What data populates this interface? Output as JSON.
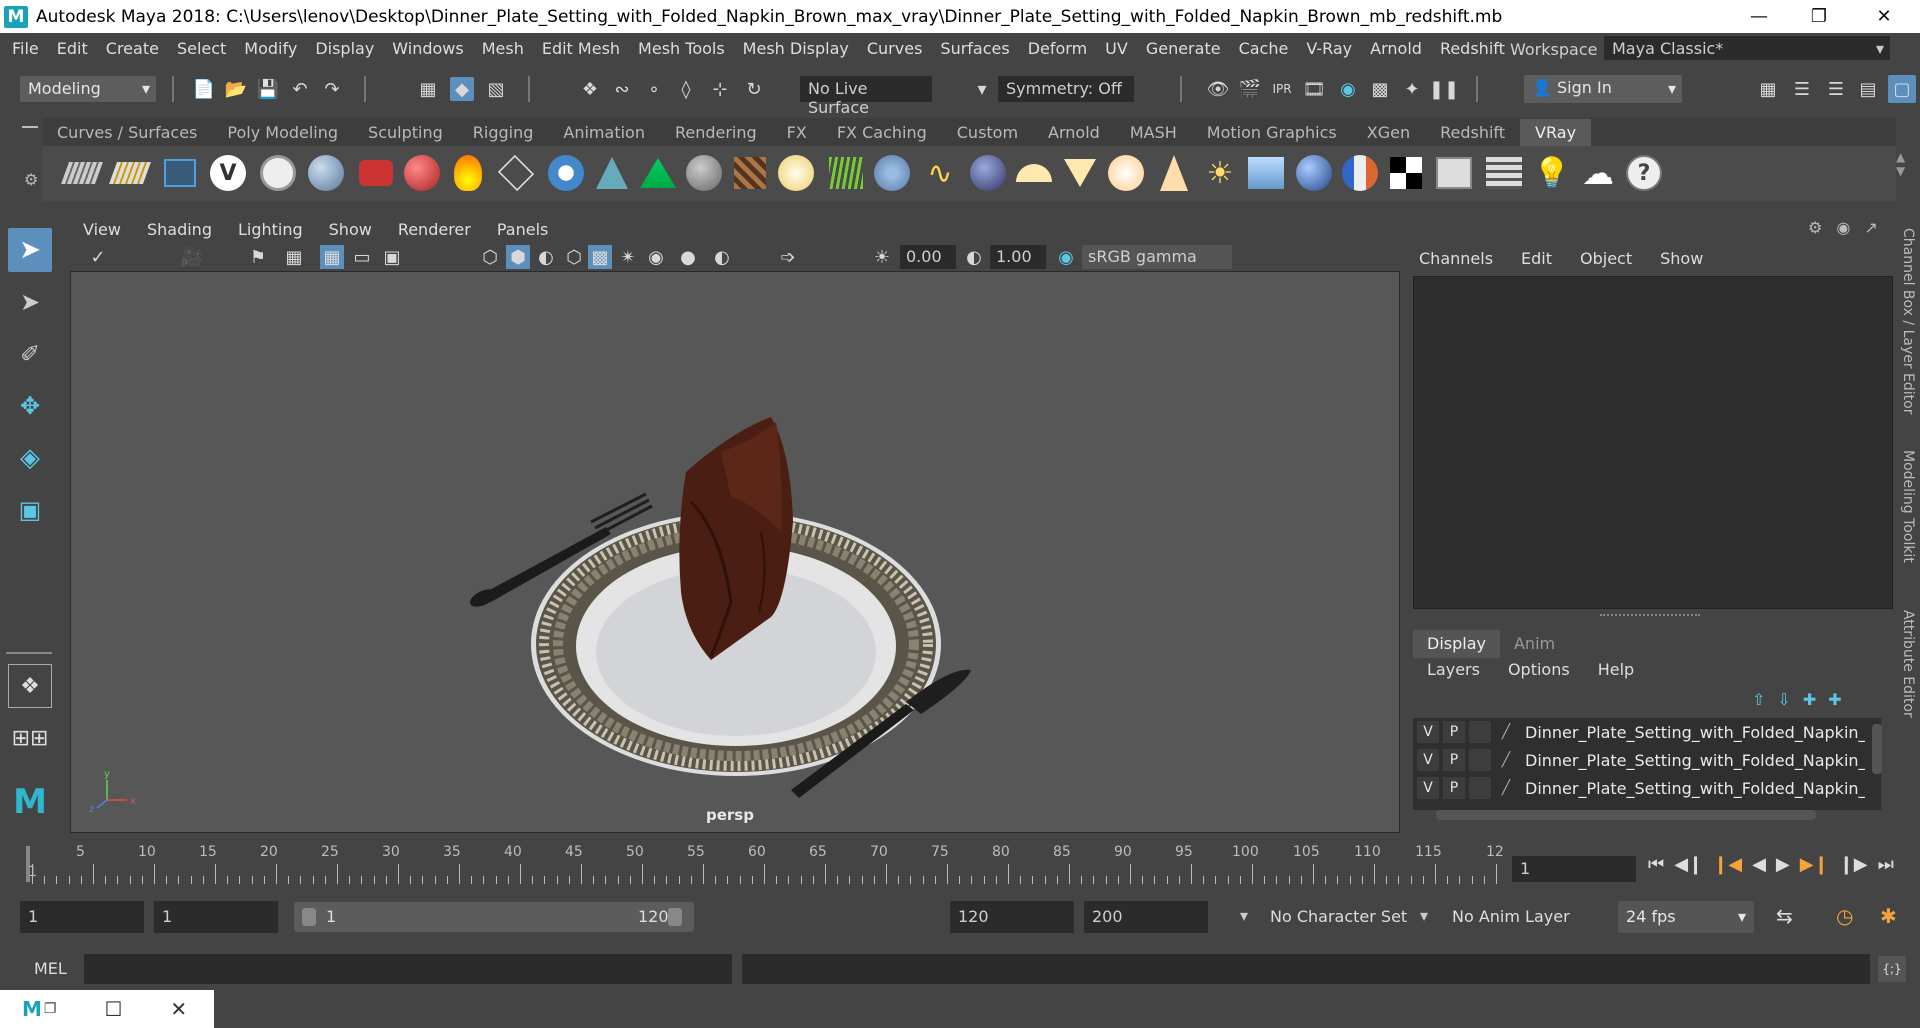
{
  "window": {
    "title": "Autodesk Maya 2018: C:\\Users\\lenov\\Desktop\\Dinner_Plate_Setting_with_Folded_Napkin_Brown_max_vray\\Dinner_Plate_Setting_with_Folded_Napkin_Brown_mb_redshift.mb",
    "logo": "M"
  },
  "menu": [
    "File",
    "Edit",
    "Create",
    "Select",
    "Modify",
    "Display",
    "Windows",
    "Mesh",
    "Edit Mesh",
    "Mesh Tools",
    "Mesh Display",
    "Curves",
    "Surfaces",
    "Deform",
    "UV",
    "Generate",
    "Cache",
    "V-Ray",
    "Arnold",
    "Redshift"
  ],
  "workspace": {
    "label": "Workspace :",
    "value": "Maya Classic*"
  },
  "status": {
    "mode": "Modeling",
    "live_surface": "No Live Surface",
    "symmetry": "Symmetry: Off",
    "sign_in": "Sign In"
  },
  "shelf": {
    "tabs": [
      "Curves / Surfaces",
      "Poly Modeling",
      "Sculpting",
      "Rigging",
      "Animation",
      "Rendering",
      "FX",
      "FX Caching",
      "Custom",
      "Arnold",
      "MASH",
      "Motion Graphics",
      "XGen",
      "Redshift",
      "VRay"
    ],
    "active_tab": "VRay"
  },
  "viewport": {
    "menu": [
      "View",
      "Shading",
      "Lighting",
      "Show",
      "Renderer",
      "Panels"
    ],
    "exposure": "0.00",
    "gamma": "1.00",
    "color_space": "sRGB gamma",
    "camera": "persp"
  },
  "channel_box": {
    "menu": [
      "Channels",
      "Edit",
      "Object",
      "Show"
    ]
  },
  "layer_editor": {
    "tabs": [
      "Display",
      "Anim"
    ],
    "menu": [
      "Layers",
      "Options",
      "Help"
    ],
    "layers": [
      {
        "v": "V",
        "p": "P",
        "name": "Dinner_Plate_Setting_with_Folded_Napkin_Brow"
      },
      {
        "v": "V",
        "p": "P",
        "name": "Dinner_Plate_Setting_with_Folded_Napkin_Brow"
      },
      {
        "v": "V",
        "p": "P",
        "name": "Dinner_Plate_Setting_with_Folded_Napkin_Brow"
      }
    ]
  },
  "side_tabs": [
    "Channel Box / Layer Editor",
    "Modeling Toolkit",
    "Attribute Editor"
  ],
  "timeline": {
    "labels": [
      "1",
      "5",
      "10",
      "15",
      "20",
      "25",
      "30",
      "35",
      "40",
      "45",
      "50",
      "55",
      "60",
      "65",
      "70",
      "75",
      "80",
      "85",
      "90",
      "95",
      "100",
      "105",
      "110",
      "115",
      "12"
    ],
    "current_frame": "1"
  },
  "range": {
    "start": "1",
    "playback_start": "1",
    "slider_start": "1",
    "slider_end": "120",
    "playback_end": "120",
    "end": "200",
    "character_set": "No Character Set",
    "anim_layer": "No Anim Layer",
    "fps": "24 fps"
  },
  "command": {
    "label": "MEL"
  }
}
